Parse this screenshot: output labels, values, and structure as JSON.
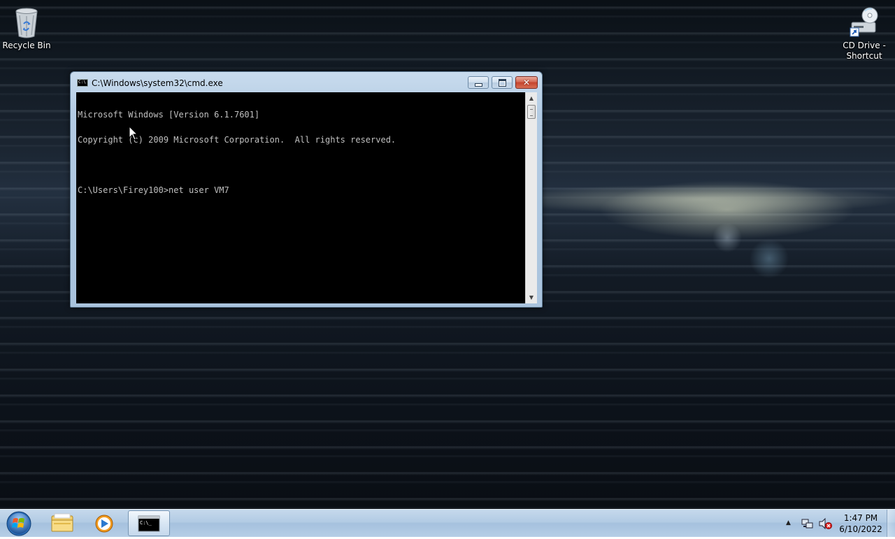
{
  "desktop": {
    "icons": [
      {
        "name": "recycle-bin",
        "label": "Recycle Bin"
      },
      {
        "name": "cd-drive-shortcut",
        "label_line1": "CD Drive -",
        "label_line2": "Shortcut"
      }
    ]
  },
  "window": {
    "title": "C:\\Windows\\system32\\cmd.exe",
    "buttons": {
      "minimize": "minimize",
      "maximize": "maximize",
      "close": "close"
    }
  },
  "console": {
    "lines": [
      "Microsoft Windows [Version 6.1.7601]",
      "Copyright (c) 2009 Microsoft Corporation.  All rights reserved.",
      "",
      "C:\\Users\\Firey100>net user VM7"
    ]
  },
  "taskbar": {
    "items": [
      {
        "name": "start-button-icon"
      },
      {
        "name": "windows-explorer-icon"
      },
      {
        "name": "media-player-icon"
      },
      {
        "name": "command-prompt-icon"
      }
    ],
    "clock": {
      "time": "1:47 PM",
      "date": "6/10/2022"
    },
    "tray_icons": [
      "show-hidden-icons-arrow",
      "network-icon",
      "volume-muted-icon"
    ]
  },
  "colors": {
    "console_bg": "#000000",
    "console_fg": "#c0c0c0",
    "taskbar": "#b2cbe4",
    "close_button": "#c4432c"
  }
}
